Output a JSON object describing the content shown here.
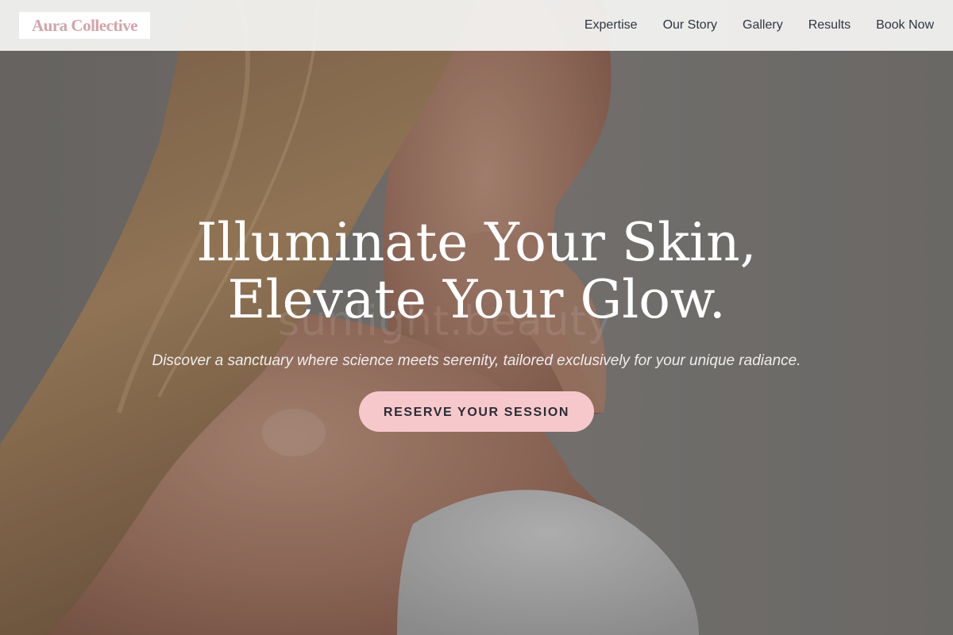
{
  "brand": {
    "name": "Aura Collective"
  },
  "nav": {
    "items": [
      {
        "label": "Expertise"
      },
      {
        "label": "Our Story"
      },
      {
        "label": "Gallery"
      },
      {
        "label": "Results"
      },
      {
        "label": "Book Now"
      }
    ]
  },
  "hero": {
    "headline_line1": "Illuminate Your Skin,",
    "headline_line2": "Elevate Your Glow.",
    "tagline": "Discover a sanctuary where science meets serenity, tailored exclusively for your unique radiance.",
    "cta_label": "RESERVE YOUR SESSION",
    "image_watermark": "sunlight.beauty",
    "image_icon": "hero-portrait-photo"
  },
  "colors": {
    "brand_pink": "#d4a3aa",
    "cta_bg": "#f6c8cc",
    "nav_text": "#2f3640",
    "headline_text": "#ffffff"
  }
}
